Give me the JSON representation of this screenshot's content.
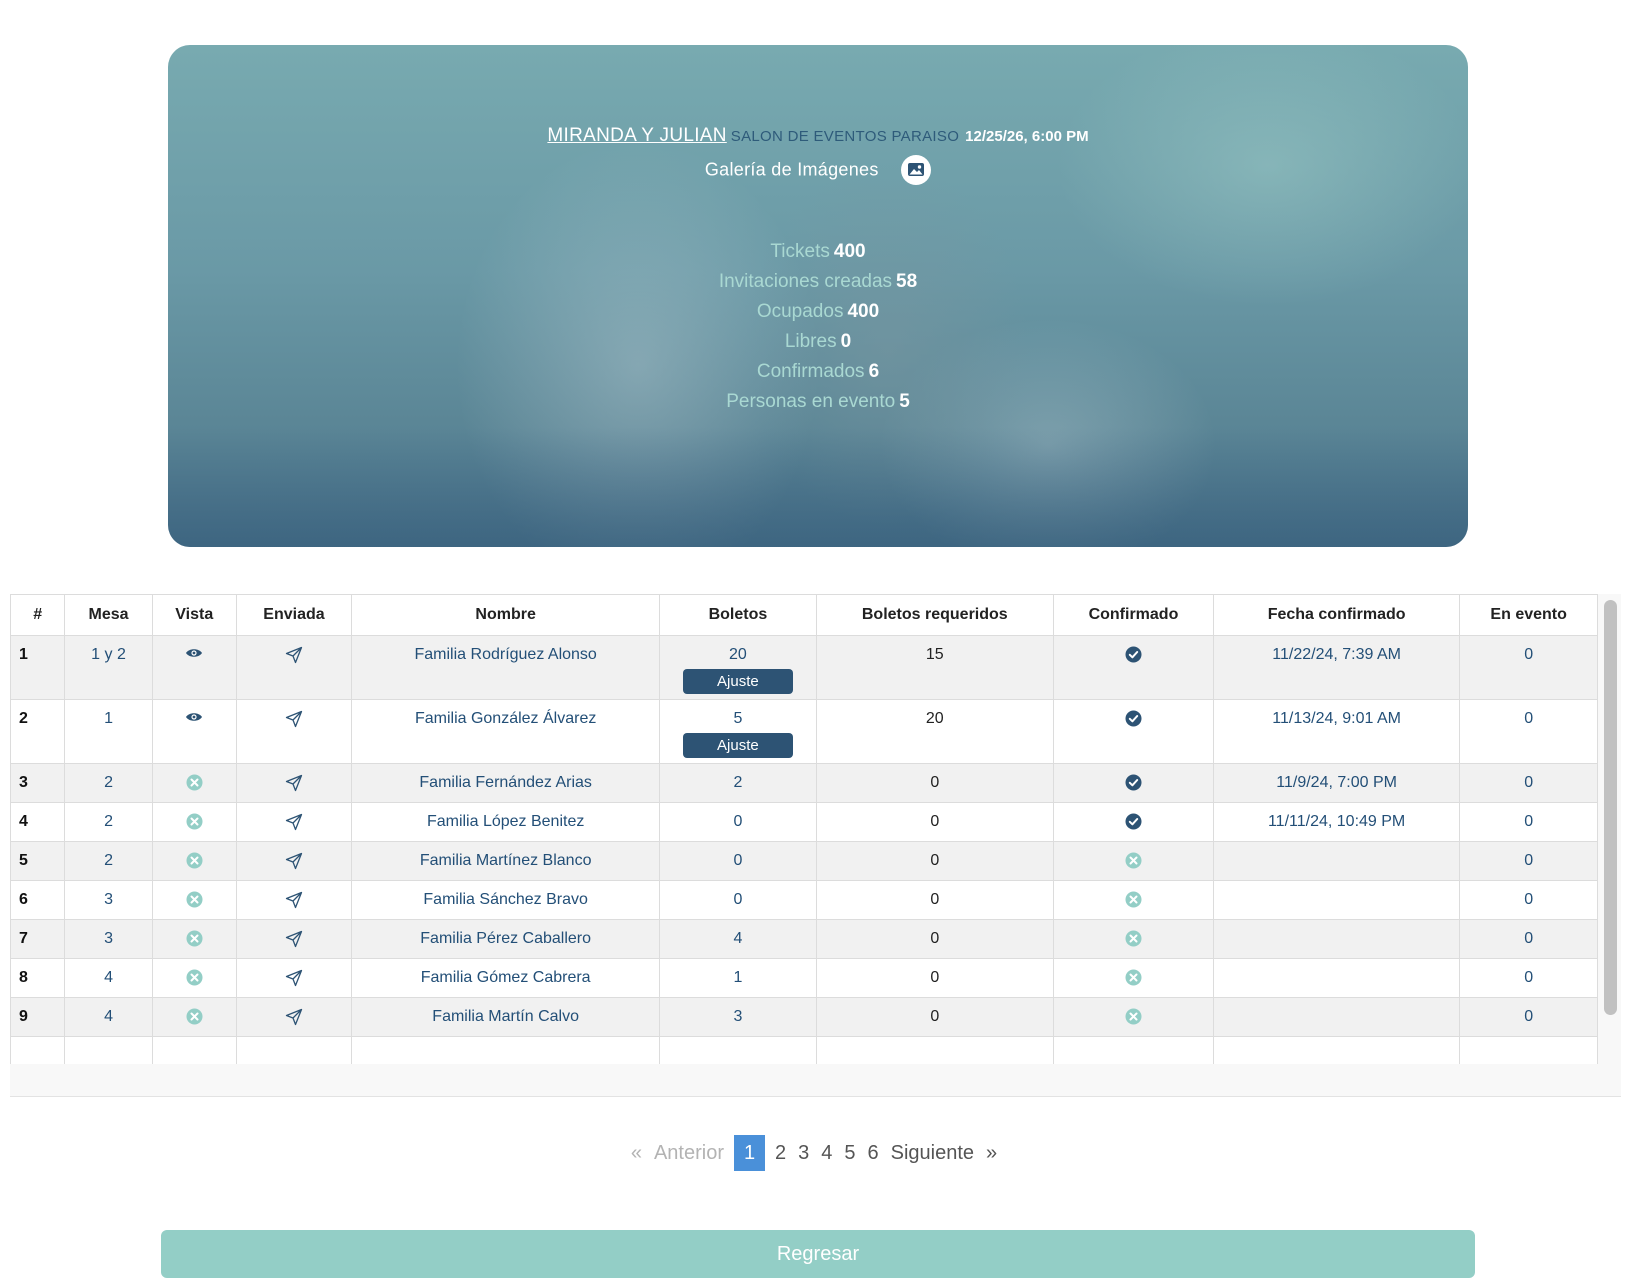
{
  "event": {
    "title": "MIRANDA Y JULIAN",
    "venue": "SALON DE EVENTOS PARAISO",
    "datetime": "12/25/26, 6:00 PM",
    "gallery_label": "Galería de Imágenes",
    "gallery_icon": "image-icon"
  },
  "stats": [
    {
      "label": "Tickets",
      "value": "400"
    },
    {
      "label": "Invitaciones creadas",
      "value": "58"
    },
    {
      "label": "Ocupados",
      "value": "400"
    },
    {
      "label": "Libres",
      "value": "0"
    },
    {
      "label": "Confirmados",
      "value": "6"
    },
    {
      "label": "Personas en evento",
      "value": "5"
    }
  ],
  "table": {
    "headers": [
      "#",
      "Mesa",
      "Vista",
      "Enviada",
      "Nombre",
      "Boletos",
      "Boletos requeridos",
      "Confirmado",
      "Fecha confirmado",
      "En evento"
    ],
    "adjust_label": "Ajuste",
    "rows": [
      {
        "num": "1",
        "mesa": "1 y 2",
        "vista": "eye",
        "enviada": "send",
        "nombre": "Familia Rodríguez Alonso",
        "boletos": "20",
        "ajuste": true,
        "requeridos": "15",
        "confirmado": "check",
        "fecha": "11/22/24, 7:39 AM",
        "en_evento": "0"
      },
      {
        "num": "2",
        "mesa": "1",
        "vista": "eye",
        "enviada": "send",
        "nombre": "Familia González Álvarez",
        "boletos": "5",
        "ajuste": true,
        "requeridos": "20",
        "confirmado": "check",
        "fecha": "11/13/24, 9:01 AM",
        "en_evento": "0"
      },
      {
        "num": "3",
        "mesa": "2",
        "vista": "x",
        "enviada": "send",
        "nombre": "Familia Fernández Arias",
        "boletos": "2",
        "ajuste": false,
        "requeridos": "0",
        "confirmado": "check",
        "fecha": "11/9/24, 7:00 PM",
        "en_evento": "0"
      },
      {
        "num": "4",
        "mesa": "2",
        "vista": "x",
        "enviada": "send",
        "nombre": "Familia López Benitez",
        "boletos": "0",
        "ajuste": false,
        "requeridos": "0",
        "confirmado": "check",
        "fecha": "11/11/24, 10:49 PM",
        "en_evento": "0"
      },
      {
        "num": "5",
        "mesa": "2",
        "vista": "x",
        "enviada": "send",
        "nombre": "Familia Martínez Blanco",
        "boletos": "0",
        "ajuste": false,
        "requeridos": "0",
        "confirmado": "x",
        "fecha": "",
        "en_evento": "0"
      },
      {
        "num": "6",
        "mesa": "3",
        "vista": "x",
        "enviada": "send",
        "nombre": "Familia Sánchez Bravo",
        "boletos": "0",
        "ajuste": false,
        "requeridos": "0",
        "confirmado": "x",
        "fecha": "",
        "en_evento": "0"
      },
      {
        "num": "7",
        "mesa": "3",
        "vista": "x",
        "enviada": "send",
        "nombre": "Familia Pérez Caballero",
        "boletos": "4",
        "ajuste": false,
        "requeridos": "0",
        "confirmado": "x",
        "fecha": "",
        "en_evento": "0"
      },
      {
        "num": "8",
        "mesa": "4",
        "vista": "x",
        "enviada": "send",
        "nombre": "Familia Gómez Cabrera",
        "boletos": "1",
        "ajuste": false,
        "requeridos": "0",
        "confirmado": "x",
        "fecha": "",
        "en_evento": "0"
      },
      {
        "num": "9",
        "mesa": "4",
        "vista": "x",
        "enviada": "send",
        "nombre": "Familia Martín Calvo",
        "boletos": "3",
        "ajuste": false,
        "requeridos": "0",
        "confirmado": "x",
        "fecha": "",
        "en_evento": "0"
      }
    ]
  },
  "pagination": {
    "prev_symbol": "«",
    "prev_label": "Anterior",
    "pages": [
      "1",
      "2",
      "3",
      "4",
      "5",
      "6"
    ],
    "current_page": "1",
    "next_label": "Siguiente",
    "next_symbol": "»"
  },
  "back_button": "Regresar",
  "colors": {
    "accent": "#93cec6",
    "primary_dark": "#2d5374",
    "link_text": "#234f77",
    "active_page": "#4a90d9",
    "stat_label": "#a9d8d2"
  }
}
